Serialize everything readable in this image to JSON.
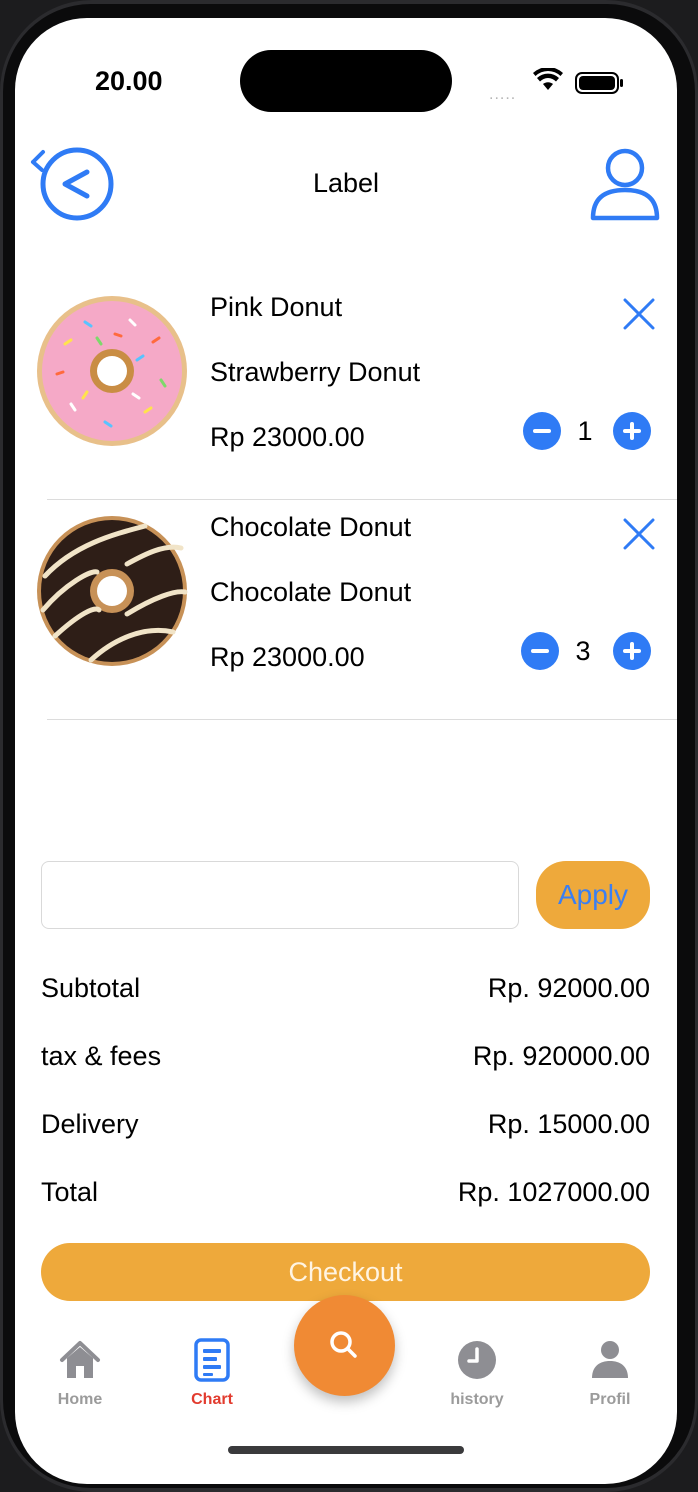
{
  "status_bar": {
    "time": "20.00",
    "signal": "....."
  },
  "header": {
    "title": "Label"
  },
  "cart": {
    "items": [
      {
        "name": "Pink Donut",
        "description": "Strawberry Donut",
        "price": "Rp 23000.00",
        "quantity": "1",
        "image_icon": "pink-donut-image"
      },
      {
        "name": "Chocolate Donut",
        "description": "Chocolate Donut",
        "price": "Rp 23000.00",
        "quantity": "3",
        "image_icon": "chocolate-donut-image"
      }
    ]
  },
  "promo": {
    "input_value": "",
    "placeholder": "",
    "apply_label": "Apply"
  },
  "summary": {
    "subtotal_label": "Subtotal",
    "subtotal_value": "Rp. 92000.00",
    "tax_label": "tax & fees",
    "tax_value": "Rp. 920000.00",
    "delivery_label": "Delivery",
    "delivery_value": "Rp. 15000.00",
    "total_label": "Total",
    "total_value": "Rp. 1027000.00"
  },
  "checkout_label": "Checkout",
  "tab_bar": {
    "items": [
      {
        "label": "Home",
        "icon": "home-icon"
      },
      {
        "label": "Chart",
        "icon": "document-icon",
        "active": true
      },
      {
        "label": "",
        "icon": "search-icon"
      },
      {
        "label": "history",
        "icon": "clock-icon"
      },
      {
        "label": "Profil",
        "icon": "person-icon"
      }
    ]
  },
  "colors": {
    "accent_blue": "#2f7bf5",
    "button_orange": "#eea93b",
    "fab_orange": "#f08a34",
    "active_tab_red": "#e23b2e"
  }
}
